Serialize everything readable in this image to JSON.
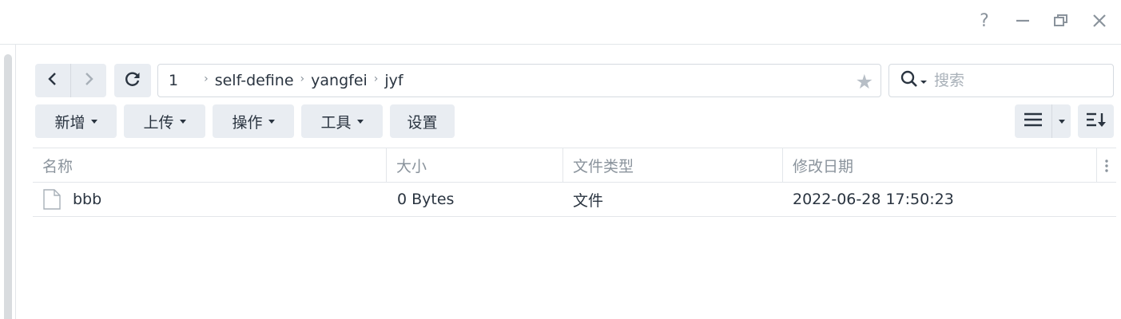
{
  "titlebar": {
    "help_icon": "question-mark-icon",
    "minimize_icon": "minimize-icon",
    "restore_icon": "restore-icon",
    "close_icon": "close-icon",
    "help_glyph": "?"
  },
  "navigation": {
    "back_icon": "chevron-left-icon",
    "forward_icon": "chevron-right-icon",
    "refresh_icon": "refresh-icon"
  },
  "path": {
    "crumbs": [
      "1",
      "self-define",
      "yangfei",
      "jyf"
    ],
    "favorite_icon": "star-icon"
  },
  "search": {
    "placeholder": "搜索",
    "value": "",
    "icon": "search-icon"
  },
  "actions": {
    "new_label": "新增",
    "upload_label": "上传",
    "action_label": "操作",
    "tools_label": "工具",
    "settings_label": "设置"
  },
  "view": {
    "list_icon": "list-view-icon",
    "sort_icon": "sort-icon"
  },
  "table": {
    "columns": [
      "名称",
      "大小",
      "文件类型",
      "修改日期"
    ],
    "rows": [
      {
        "name": "bbb",
        "size": "0 Bytes",
        "type": "文件",
        "modified": "2022-06-28 17:50:23",
        "icon": "file-icon"
      }
    ]
  },
  "colors": {
    "button_bg": "#e9edf2",
    "border": "#d5dae0",
    "muted_text": "#8a939c",
    "text": "#2a3440"
  }
}
